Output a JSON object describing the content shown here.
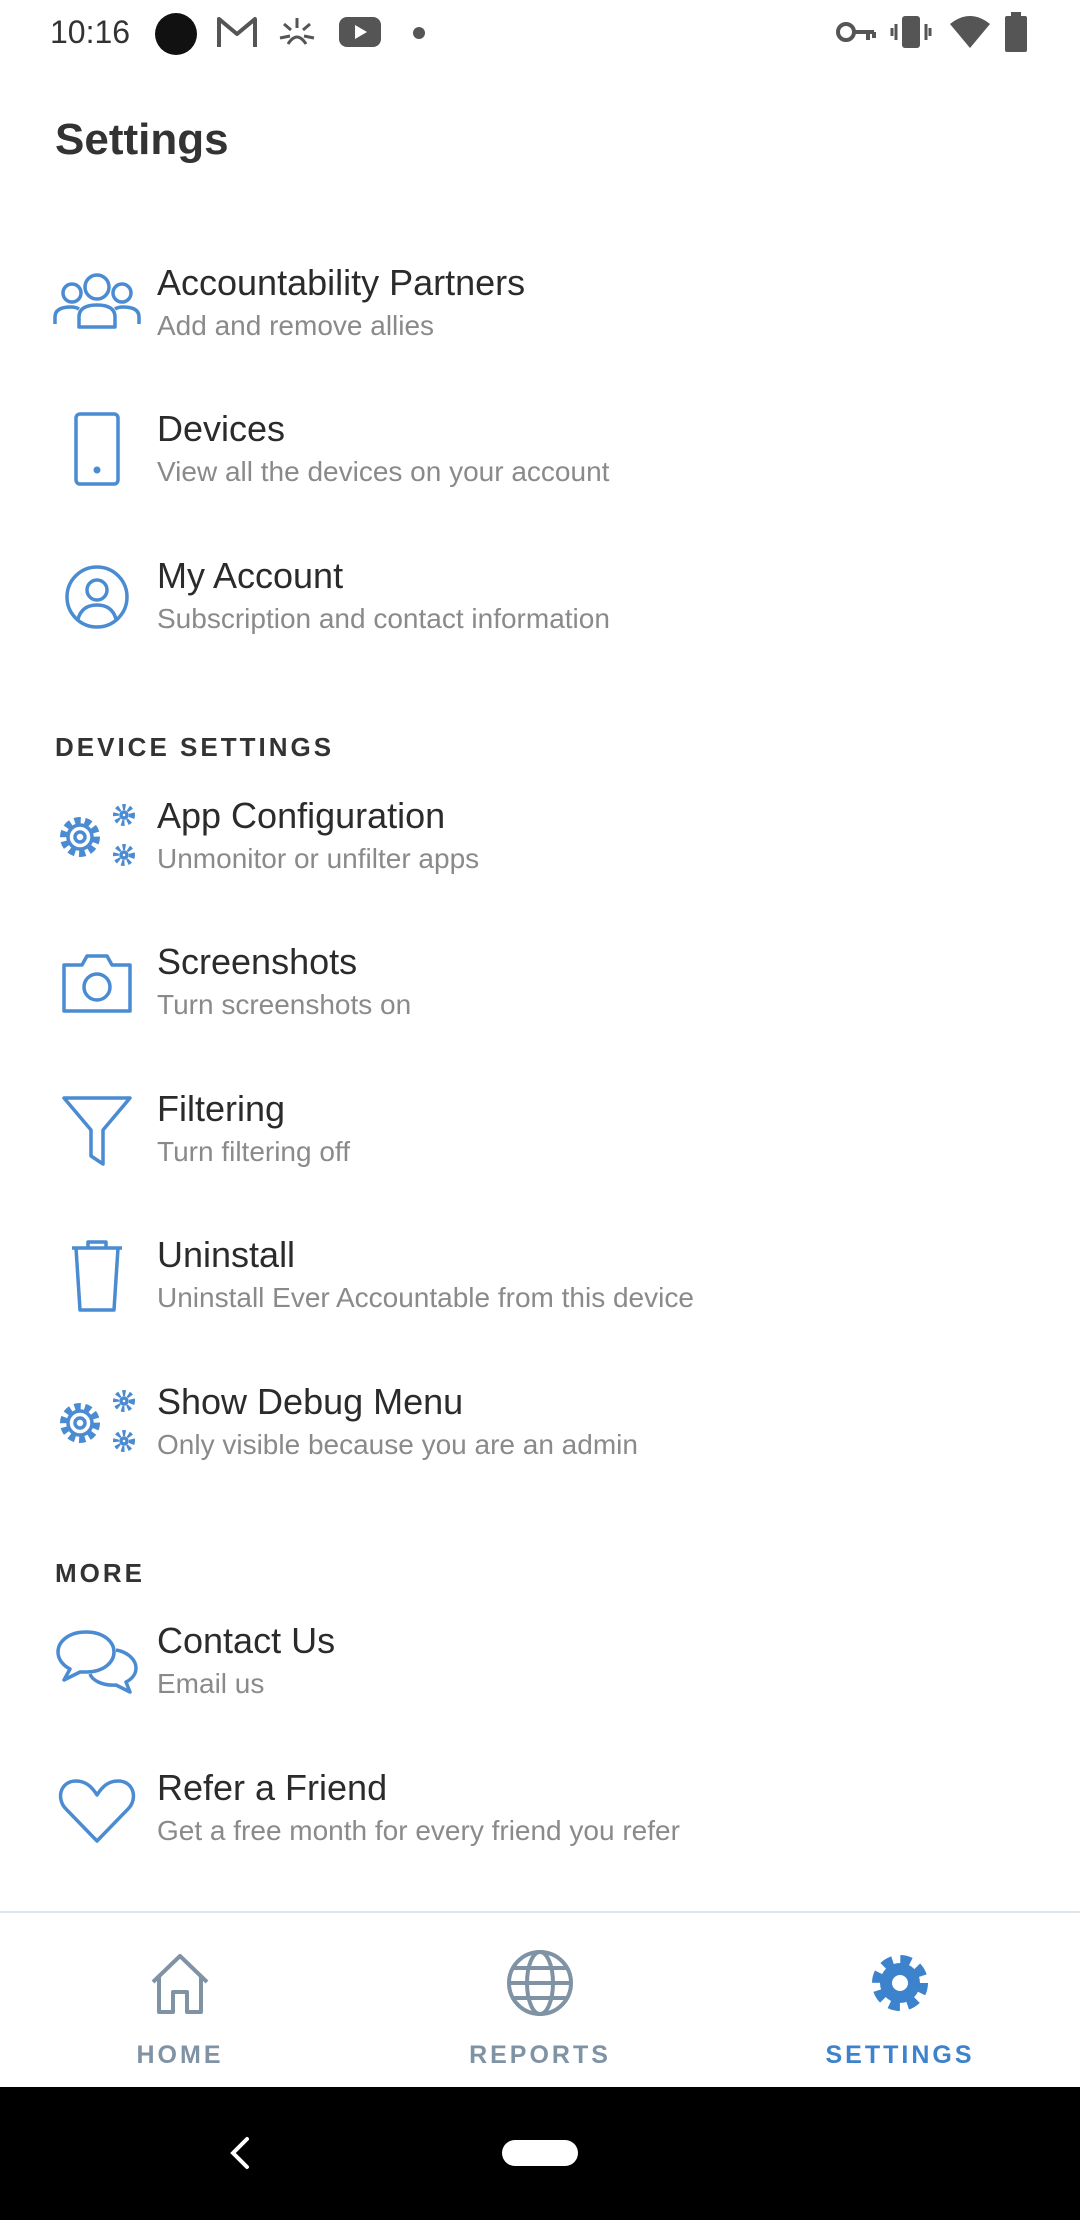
{
  "status_bar": {
    "time": "10:16"
  },
  "page": {
    "title": "Settings"
  },
  "account_items": [
    {
      "icon": "users-icon",
      "title": "Accountability Partners",
      "subtitle": "Add and remove allies"
    },
    {
      "icon": "device-icon",
      "title": "Devices",
      "subtitle": "View all the devices on your account"
    },
    {
      "icon": "user-circle-icon",
      "title": "My Account",
      "subtitle": "Subscription and contact information"
    }
  ],
  "device_settings": {
    "header": "DEVICE SETTINGS",
    "items": [
      {
        "icon": "gears-icon",
        "title": "App Configuration",
        "subtitle": "Unmonitor or unfilter apps"
      },
      {
        "icon": "camera-icon",
        "title": "Screenshots",
        "subtitle": "Turn screenshots on"
      },
      {
        "icon": "filter-icon",
        "title": "Filtering",
        "subtitle": "Turn filtering off"
      },
      {
        "icon": "trash-icon",
        "title": "Uninstall",
        "subtitle": "Uninstall Ever Accountable from this device"
      },
      {
        "icon": "gears-icon",
        "title": "Show Debug Menu",
        "subtitle": "Only visible because you are an admin"
      }
    ]
  },
  "more": {
    "header": "MORE",
    "items": [
      {
        "icon": "chat-icon",
        "title": "Contact Us",
        "subtitle": "Email us"
      },
      {
        "icon": "heart-icon",
        "title": "Refer a Friend",
        "subtitle": "Get a free month for every friend you refer"
      }
    ]
  },
  "bottom_nav": {
    "items": [
      {
        "icon": "home-icon",
        "label": "HOME",
        "active": false
      },
      {
        "icon": "globe-icon",
        "label": "REPORTS",
        "active": false
      },
      {
        "icon": "gear-icon",
        "label": "SETTINGS",
        "active": true
      }
    ]
  },
  "colors": {
    "accent": "#3d82cc",
    "icon_blue": "#4a8bd2",
    "inactive_nav": "#7f93a5",
    "subtitle_gray": "#8a8a8a"
  }
}
